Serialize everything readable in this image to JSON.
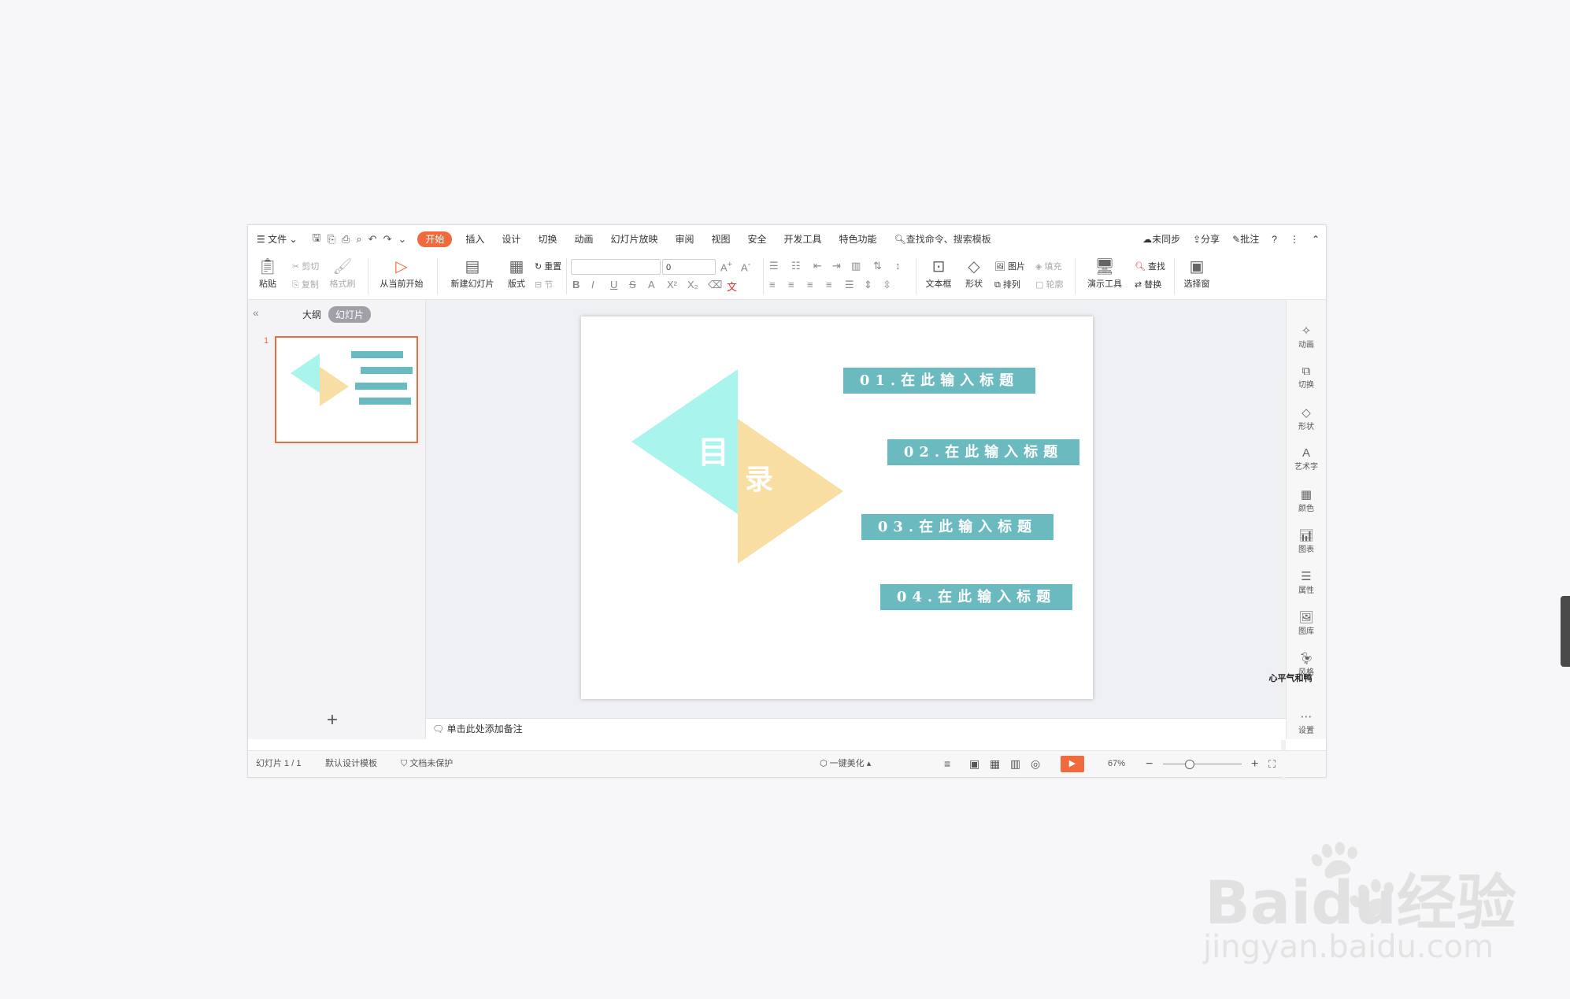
{
  "menubar": {
    "file": "文件",
    "tabs": [
      "开始",
      "插入",
      "设计",
      "切换",
      "动画",
      "幻灯片放映",
      "审阅",
      "视图",
      "安全",
      "开发工具",
      "特色功能"
    ],
    "active_tab": "开始",
    "search": "查找命令、搜索模板",
    "sync": "未同步",
    "share": "分享",
    "review": "批注",
    "help": "?"
  },
  "ribbon": {
    "paste": "粘贴",
    "cut": "剪切",
    "copy": "复制",
    "format_painter": "格式刷",
    "from_current": "从当前开始",
    "new_slide": "新建幻灯片",
    "layout": "版式",
    "reset": "重置",
    "section": "节",
    "font_size": "0",
    "textbox": "文本框",
    "shape": "形状",
    "picture": "图片",
    "arrange": "排列",
    "fill": "填充",
    "outline": "轮廓",
    "present_tools": "演示工具",
    "find": "查找",
    "replace": "替换",
    "select_pane": "选择窗"
  },
  "leftpanel": {
    "outline_tab": "大纲",
    "slides_tab": "幻灯片",
    "slide_number": "1",
    "add": "+"
  },
  "slide": {
    "title_char1": "目",
    "title_char2": "录",
    "items": [
      "01.在此输入标题",
      "02.在此输入标题",
      "03.在此输入标题",
      "04.在此输入标题"
    ]
  },
  "notes": {
    "placeholder": "单击此处添加备注"
  },
  "rightbar": {
    "items": [
      "动画",
      "切换",
      "形状",
      "艺术字",
      "颜色",
      "图表",
      "属性",
      "图库",
      "风格",
      "设置"
    ]
  },
  "status": {
    "slide_count": "幻灯片 1 / 1",
    "template": "默认设计模板",
    "protect": "文档未保护",
    "beautify": "一键美化",
    "zoom": "67%"
  },
  "sticker_text": "心平气和鸭",
  "watermark": {
    "logo": "Baidu经验",
    "url": "jingyan.baidu.com"
  }
}
